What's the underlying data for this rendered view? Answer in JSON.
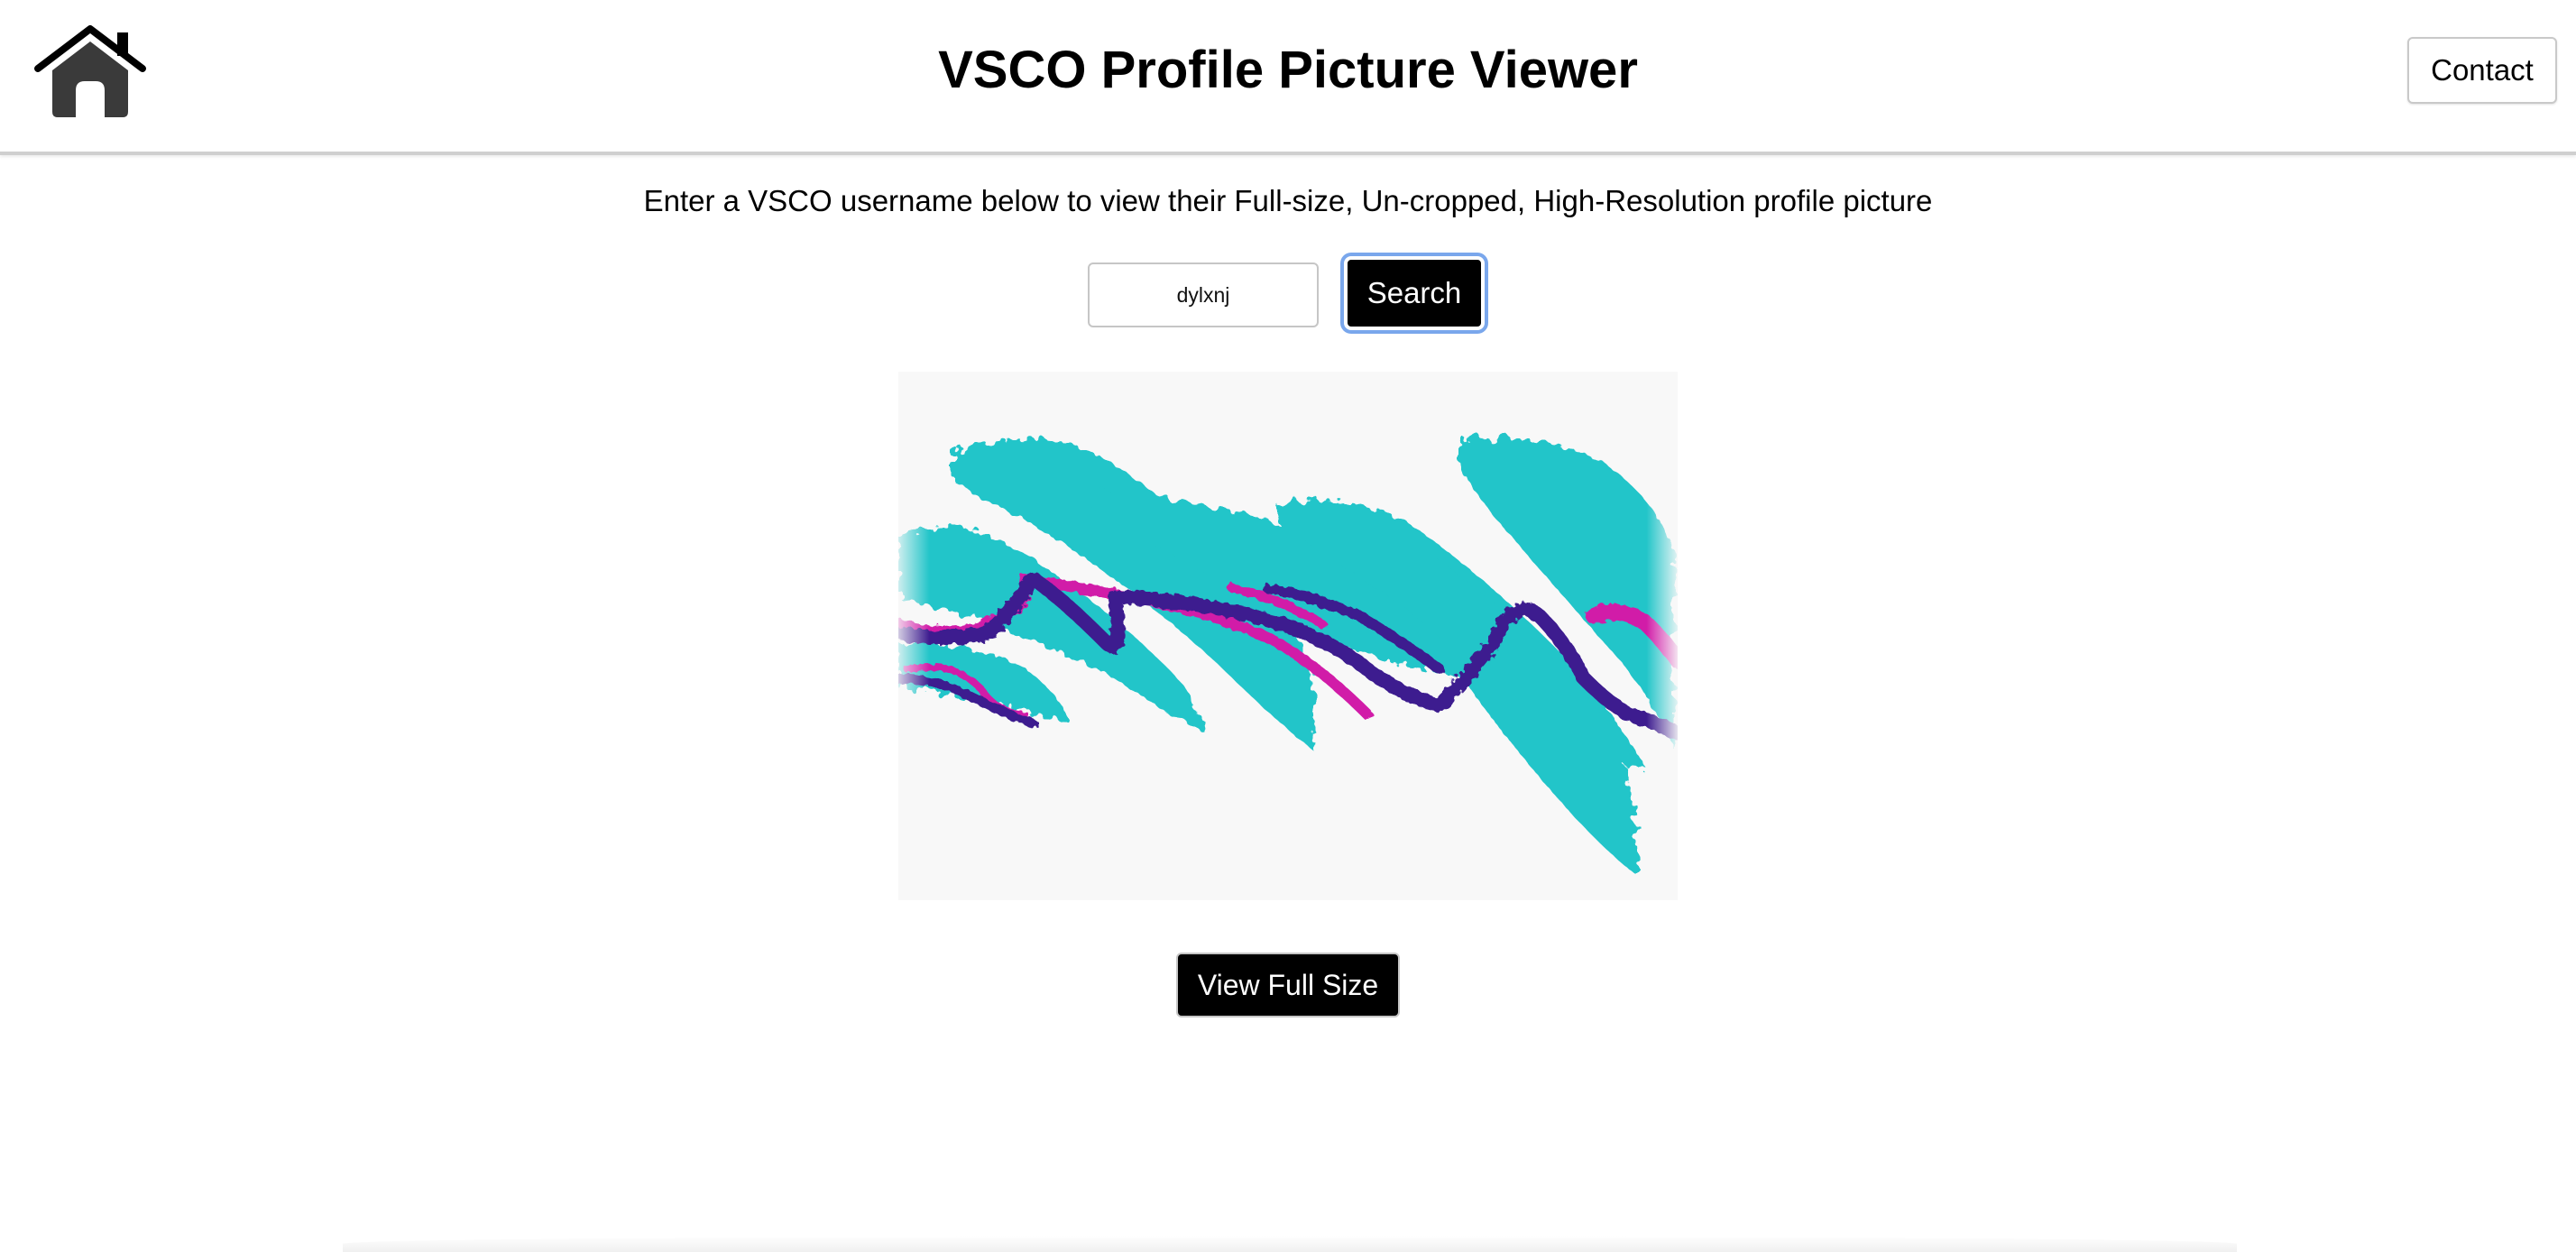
{
  "header": {
    "title": "VSCO Profile Picture Viewer",
    "home_icon": "home-icon",
    "contact_label": "Contact"
  },
  "main": {
    "subtitle": "Enter a VSCO username below to view their Full-size, Un-cropped, High-Resolution profile picture",
    "search": {
      "value": "dylxnj",
      "button_label": "Search"
    },
    "profile_picture": {
      "content": "abstract teal, purple and magenta brush-stroke pattern"
    },
    "view_full_size_label": "View Full Size"
  },
  "colors": {
    "teal": "#22c5c9",
    "purple": "#3e1f8f",
    "magenta": "#d11fa8",
    "focus_ring": "#7aa7ec",
    "button_black": "#000000"
  }
}
